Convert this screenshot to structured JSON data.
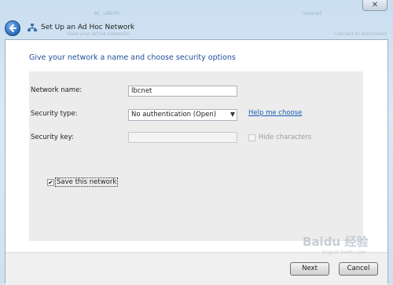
{
  "window": {
    "title": "Set Up an Ad Hoc Network",
    "close_glyph": "✕",
    "background_hints": [
      "BC_LBN-PC",
      "Internet",
      "View your active networks",
      "Connect or disconnect"
    ]
  },
  "main": {
    "heading": "Give your network a name and choose security options"
  },
  "form": {
    "network_name": {
      "label": "Network name:",
      "value": "lbcnet"
    },
    "security_type": {
      "label": "Security type:",
      "value": "No authentication (Open)",
      "help_link": "Help me choose"
    },
    "security_key": {
      "label": "Security key:",
      "value": "",
      "hide_chars_label": "Hide characters",
      "hide_chars_checked": false
    },
    "save_network": {
      "label": "Save this network",
      "checked": true,
      "check_glyph": "✔"
    }
  },
  "footer": {
    "next_label": "Next",
    "cancel_label": "Cancel"
  },
  "watermark": {
    "text": "Baidu 经验",
    "sub": "jingyan.baidu.com"
  },
  "colors": {
    "heading": "#1f4e99",
    "link": "#1a5fb4",
    "panel": "#ececec"
  }
}
